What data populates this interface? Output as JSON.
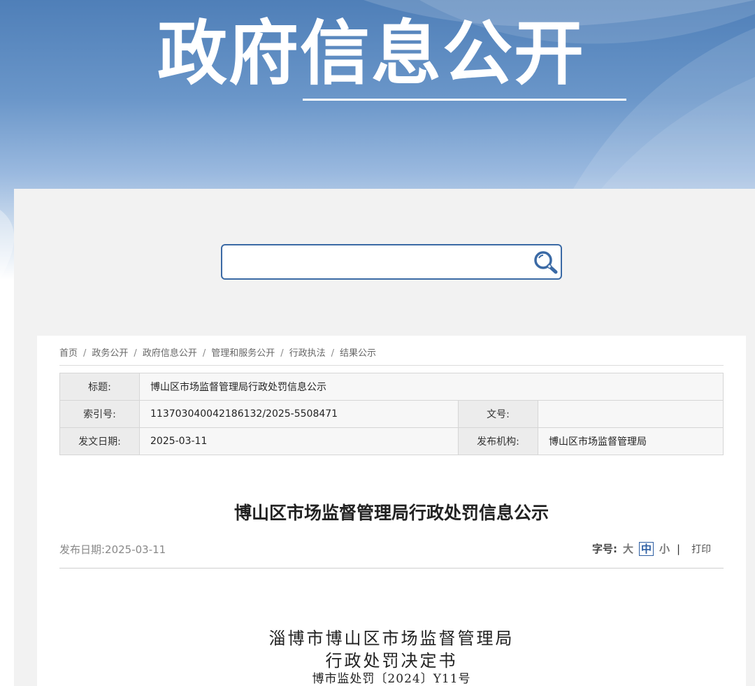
{
  "banner": {
    "title": "政府信息公开"
  },
  "search": {
    "placeholder": "",
    "value": "",
    "icon": "search-icon"
  },
  "breadcrumb": [
    "首页",
    "政务公开",
    "政府信息公开",
    "管理和服务公开",
    "行政执法",
    "结果公示"
  ],
  "breadcrumb_separator": "/",
  "meta": {
    "title_label": "标题:",
    "title_value": "博山区市场监督管理局行政处罚信息公示",
    "index_label": "索引号:",
    "index_value": "113703040042186132/2025-5508471",
    "docno_label": "文号:",
    "docno_value": "",
    "date_label": "发文日期:",
    "date_value": "2025-03-11",
    "org_label": "发布机构:",
    "org_value": "博山区市场监督管理局"
  },
  "article": {
    "title": "博山区市场监督管理局行政处罚信息公示",
    "publish_date": "发布日期:2025-03-11",
    "font_size_label": "字号:",
    "font_large": "大",
    "font_medium": "中",
    "font_small": "小",
    "divider": "|",
    "print_label": "打印",
    "body_line1": "淄博市博山区市场监督管理局",
    "body_line2": "行政处罚决定书",
    "body_line3": "博市监处罚〔2024〕Y11号"
  },
  "colors": {
    "accent": "#2e5fa3",
    "search_border": "#3b6aa5",
    "panel_bg": "#f2f2f2"
  }
}
